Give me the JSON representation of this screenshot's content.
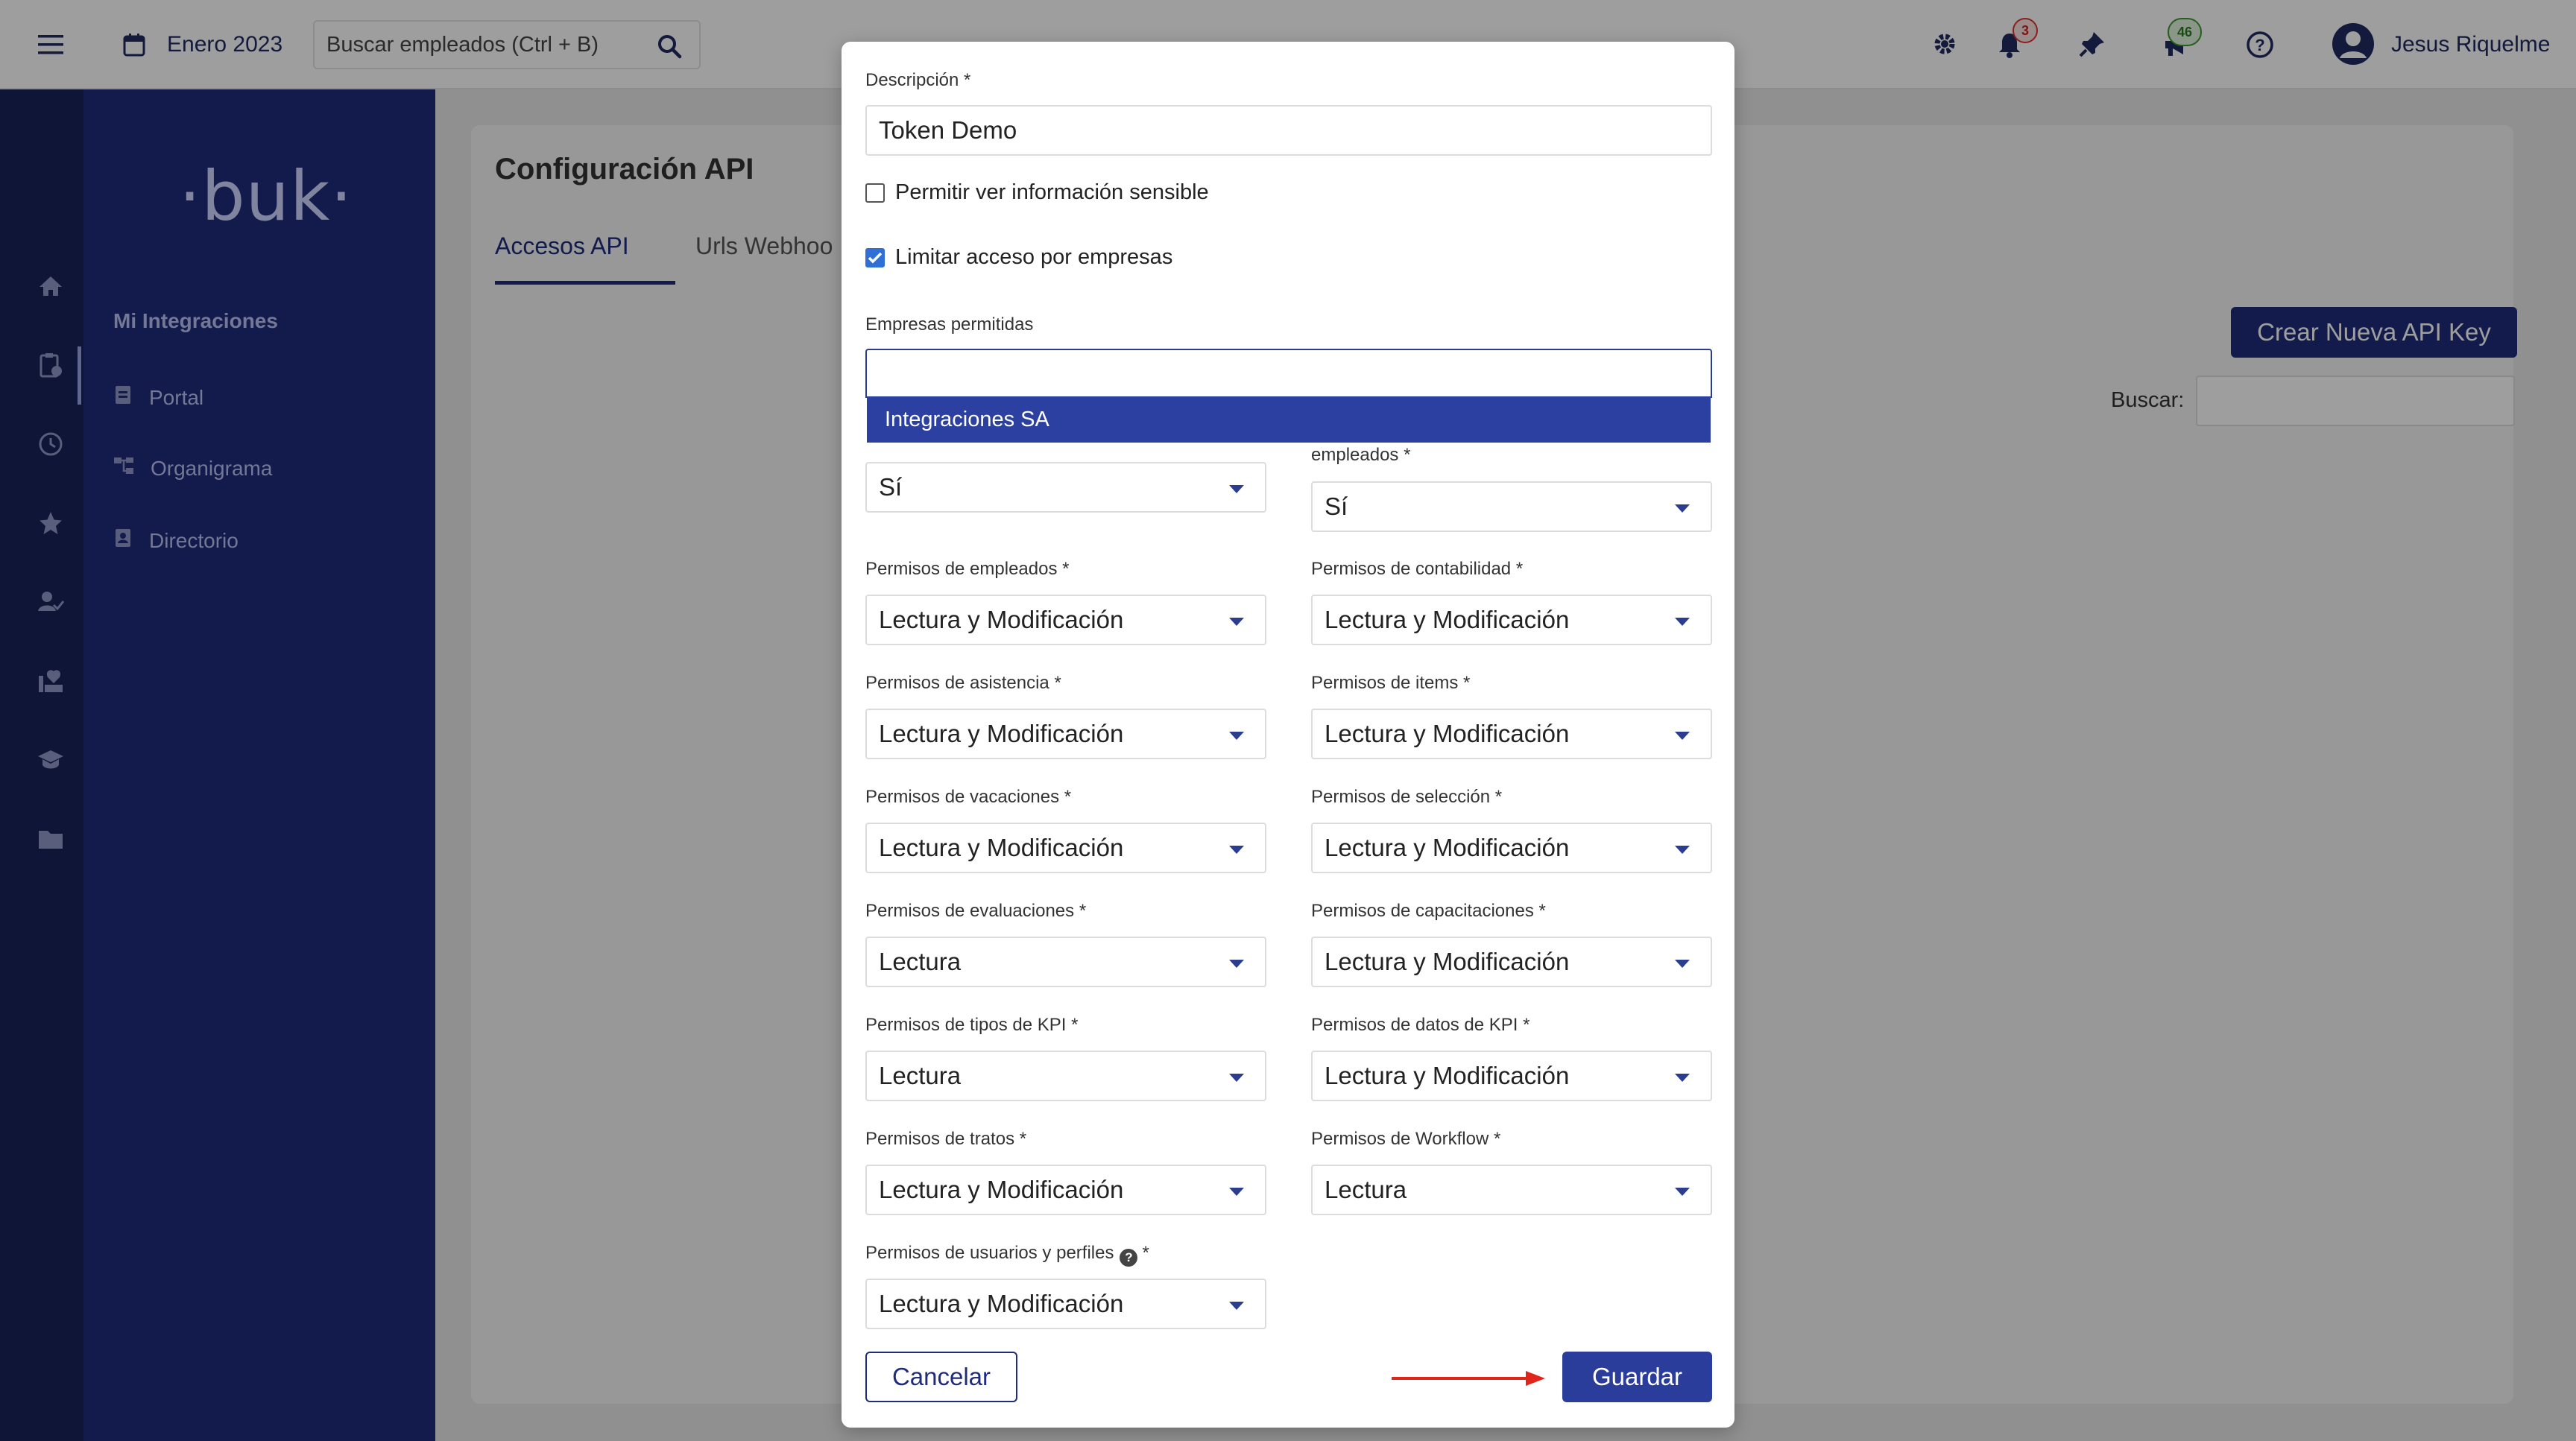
{
  "topbar": {
    "period": "Enero 2023",
    "search_placeholder": "Buscar empleados (Ctrl + B)",
    "notifications_count": "3",
    "messages_count": "46",
    "user_name": "Jesus Riquelme"
  },
  "sidebar": {
    "logo": "·buk·",
    "title": "Mi Integraciones",
    "items": [
      {
        "label": "Portal",
        "icon": "document-icon"
      },
      {
        "label": "Organigrama",
        "icon": "org-chart-icon"
      },
      {
        "label": "Directorio",
        "icon": "contacts-icon"
      }
    ]
  },
  "page": {
    "title": "Configuración API",
    "tabs": [
      {
        "label": "Accesos API",
        "active": true
      },
      {
        "label": "Urls Webhoo",
        "active": false
      }
    ],
    "create_button": "Crear Nueva API Key",
    "search_label": "Buscar:"
  },
  "modal": {
    "description_label": "Descripción *",
    "description_value": "Token Demo",
    "sensitive_label": "Permitir ver información sensible",
    "sensitive_checked": false,
    "limit_label": "Limitar acceso por empresas",
    "limit_checked": true,
    "companies_label": "Empresas permitidas",
    "companies_option": "Integraciones SA",
    "row0": {
      "left_value": "Sí",
      "right_label": "empleados *",
      "right_value": "Sí"
    },
    "permissions": [
      {
        "label": "Permisos de empleados *",
        "value": "Lectura y Modificación"
      },
      {
        "label": "Permisos de contabilidad *",
        "value": "Lectura y Modificación"
      },
      {
        "label": "Permisos de asistencia *",
        "value": "Lectura y Modificación"
      },
      {
        "label": "Permisos de items *",
        "value": "Lectura y Modificación"
      },
      {
        "label": "Permisos de vacaciones *",
        "value": "Lectura y Modificación"
      },
      {
        "label": "Permisos de selección *",
        "value": "Lectura y Modificación"
      },
      {
        "label": "Permisos de evaluaciones *",
        "value": "Lectura"
      },
      {
        "label": "Permisos de capacitaciones *",
        "value": "Lectura y Modificación"
      },
      {
        "label": "Permisos de tipos de KPI *",
        "value": "Lectura"
      },
      {
        "label": "Permisos de datos de KPI *",
        "value": "Lectura y Modificación"
      },
      {
        "label": "Permisos de tratos *",
        "value": "Lectura y Modificación"
      },
      {
        "label": "Permisos de Workflow *",
        "value": "Lectura"
      }
    ],
    "users_label": "Permisos de usuarios y perfiles",
    "users_required": "*",
    "users_value": "Lectura y Modificación",
    "cancel_label": "Cancelar",
    "save_label": "Guardar"
  },
  "colors": {
    "brand_navy": "#1e2c7a",
    "accent_blue": "#2b3d9a",
    "arrow_red": "#e0261b"
  }
}
